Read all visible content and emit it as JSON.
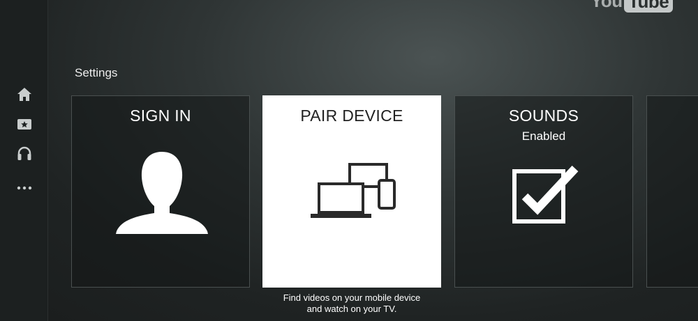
{
  "brand": {
    "part1": "You",
    "part2": "Tube"
  },
  "sidebar": {
    "items": [
      {
        "icon": "home-icon"
      },
      {
        "icon": "subscriptions-icon"
      },
      {
        "icon": "headphones-icon"
      },
      {
        "icon": "more-icon"
      }
    ]
  },
  "page": {
    "heading": "Settings"
  },
  "tiles": [
    {
      "title": "SIGN IN",
      "icon": "person-silhouette-icon"
    },
    {
      "title": "PAIR DEVICE",
      "icon": "devices-icon",
      "caption_line1": "Find videos on your mobile device",
      "caption_line2": "and watch on your TV."
    },
    {
      "title": "SOUNDS",
      "subtitle": "Enabled",
      "icon": "checkbox-checked-icon"
    }
  ],
  "colors": {
    "selected_tile": "#ffffff",
    "tile_border": "#4a5050"
  }
}
